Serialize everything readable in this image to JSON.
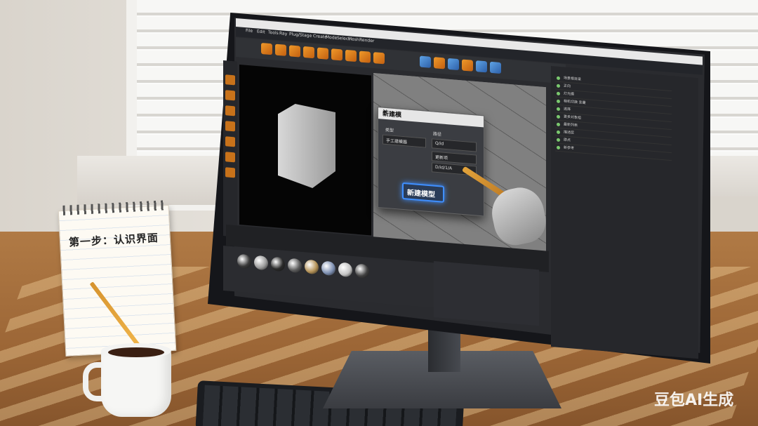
{
  "notebook": {
    "title": "第一步：认识界面"
  },
  "screen": {
    "menu": [
      "File",
      "Edit",
      "Tools",
      "Ray",
      "Plug/Stage",
      "Create",
      "Mode",
      "Select",
      "Mesh",
      "Render"
    ],
    "dialog": {
      "title": "新建模",
      "left_label": "类型",
      "left_value": "手工建模器",
      "right_label": "路径",
      "right_value": "Q/id",
      "field2": "更新项",
      "field3": "D/id/1/A",
      "button": "新建模型"
    },
    "outliner": [
      "场景根目录",
      "正向",
      "灯光摄",
      "相机切换 变量",
      "选择",
      "更多对象组",
      "最新列表",
      "描述层",
      "原点",
      "新参考"
    ]
  },
  "watermark": "豆包AI生成",
  "materials": [
    {
      "color": "#3a3a3a"
    },
    {
      "color": "#9a9a9a"
    },
    {
      "color": "#2a2a2a"
    },
    {
      "color": "#5b5b5b"
    },
    {
      "color": "#b49257"
    },
    {
      "color": "#7d8fb1"
    },
    {
      "color": "#c4c4c4"
    },
    {
      "color": "#404040"
    }
  ]
}
